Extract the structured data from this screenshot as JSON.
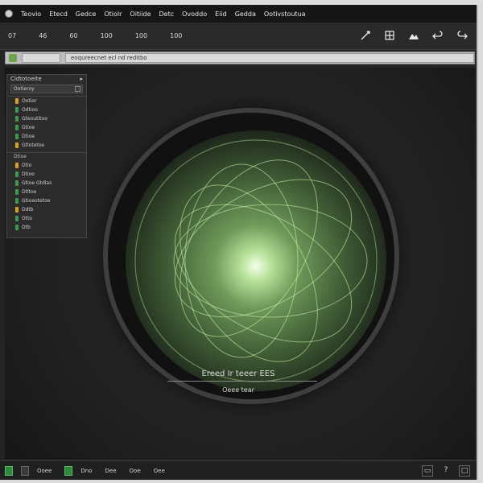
{
  "menu": {
    "items": [
      "Teovio",
      "Etecd",
      "Gedce",
      "Otiolr",
      "Oitiide",
      "Detc",
      "Ovoddo",
      "Eiid",
      "Gedda",
      "Ootivstoutua"
    ]
  },
  "toolbar": {
    "buttons": [
      "07",
      "46",
      "60",
      "100",
      "100",
      "100"
    ],
    "right_icons": [
      "wand-icon",
      "grid-icon",
      "mountain-icon",
      "undo-icon",
      "redo-icon"
    ]
  },
  "address": {
    "short_value": "",
    "value": "eoqureecnet ecl nd reditbo"
  },
  "panel": {
    "title": "Cidtotoeite",
    "search": "Ootieroy",
    "groups": [
      {
        "title": "",
        "items": [
          {
            "label": "Ootior",
            "color": "#d9a21b"
          },
          {
            "label": "Odtioo",
            "color": "#3c9a4d"
          },
          {
            "label": "Gteoutitoo",
            "color": "#3c9a4d"
          },
          {
            "label": "Gtioe",
            "color": "#3c9a4d"
          },
          {
            "label": "Dtioe",
            "color": "#3c9a4d"
          },
          {
            "label": "Gtlotetoe",
            "color": "#d9a21b"
          }
        ]
      },
      {
        "title": "Dtioe",
        "items": [
          {
            "label": "Dtio",
            "color": "#d9a21b"
          },
          {
            "label": "Dtioo",
            "color": "#3c9a4d"
          },
          {
            "label": "Gtioe Gtdlas",
            "color": "#3c9a4d"
          },
          {
            "label": "Dtltoe",
            "color": "#3c9a4d"
          },
          {
            "label": "Gtioeotetoe",
            "color": "#3c9a4d"
          },
          {
            "label": "Ddtb",
            "color": "#d9a21b"
          },
          {
            "label": "Otto",
            "color": "#3c9a4d"
          },
          {
            "label": "Dtb",
            "color": "#3c9a4d"
          }
        ]
      }
    ]
  },
  "caption": {
    "title": "Ereed Ir teeer EES",
    "subtitle": "Oeee tear"
  },
  "status": {
    "labels": [
      "Ooee",
      "Dno",
      "Dee",
      "Ooe",
      "Oee"
    ]
  }
}
